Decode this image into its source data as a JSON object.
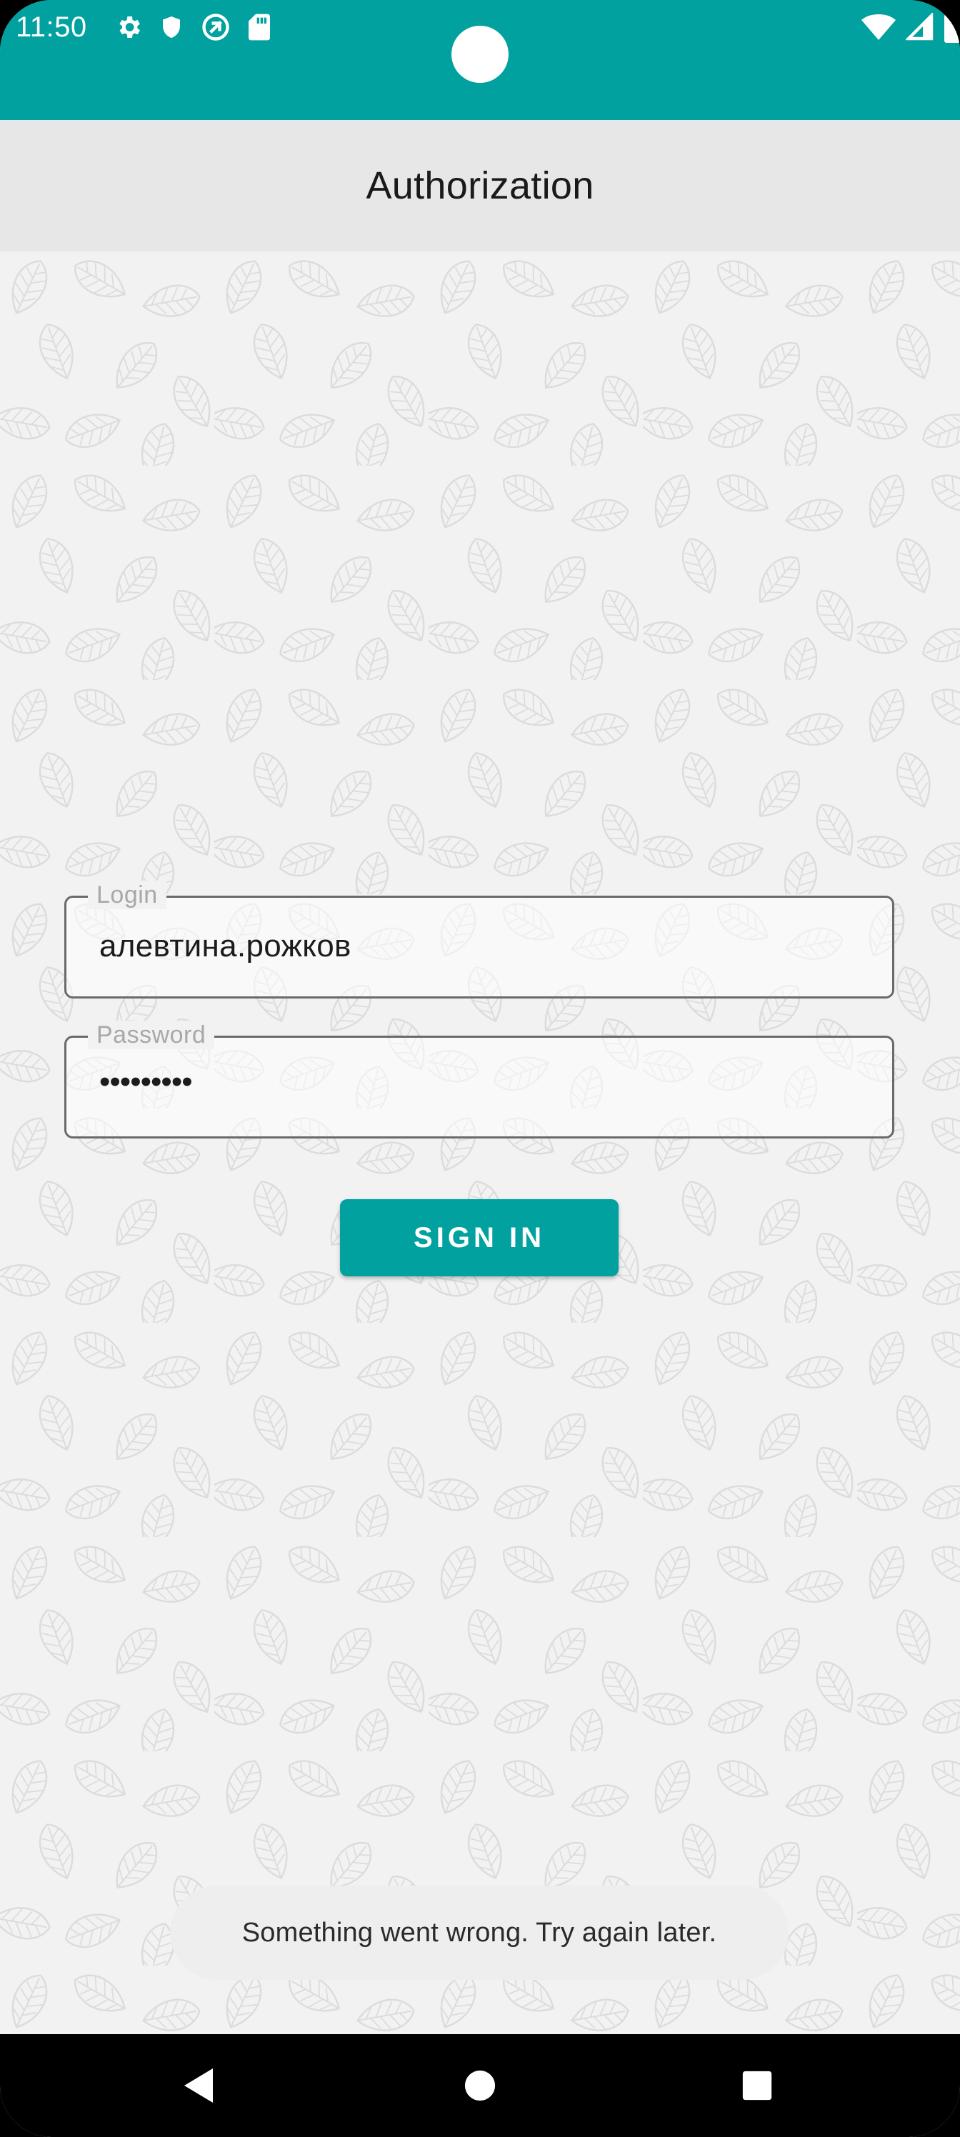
{
  "status_bar": {
    "time": "11:50",
    "left_icons": [
      "gear-icon",
      "shield-icon",
      "at-sign-icon",
      "sd-card-icon"
    ],
    "right_icons": [
      "wifi-icon",
      "cell-signal-icon",
      "battery-icon"
    ],
    "color": "#00a19f"
  },
  "app_bar": {
    "title": "Authorization"
  },
  "form": {
    "login": {
      "label": "Login",
      "value": "алевтина.рожков"
    },
    "password": {
      "label": "Password",
      "value": "•••••••••"
    },
    "sign_in_label": "SIGN IN",
    "accent": "#00a19f"
  },
  "toast": {
    "message": "Something went wrong. Try again later."
  },
  "nav_bar": {
    "buttons": [
      "back-icon",
      "home-icon",
      "recents-icon"
    ]
  }
}
